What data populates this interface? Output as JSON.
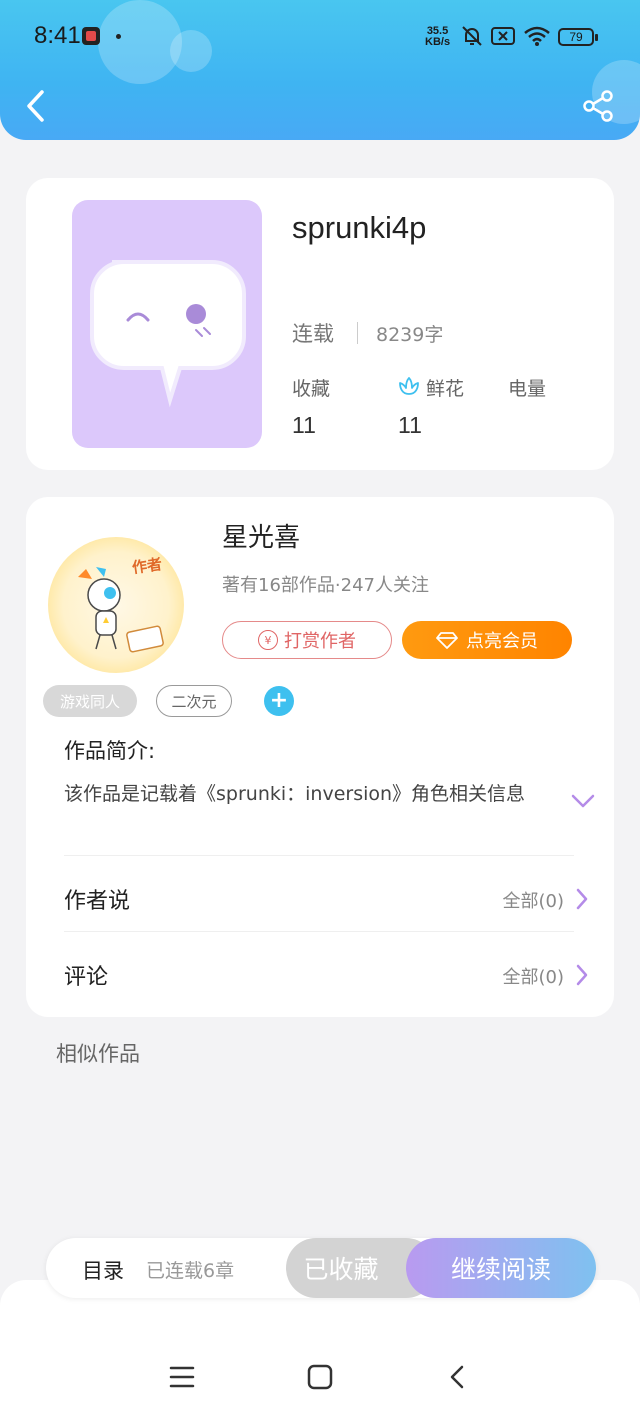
{
  "status_bar": {
    "time": "8:41",
    "net_speed_value": "35.5",
    "net_speed_unit": "KB/s",
    "battery": "79"
  },
  "book": {
    "title": "sprunki4p",
    "status": "连载",
    "word_count": "8239字",
    "stats": [
      {
        "label": "收藏",
        "value": "11"
      },
      {
        "label": "鲜花",
        "value": "11"
      },
      {
        "label": "电量",
        "value": ""
      }
    ]
  },
  "author": {
    "name": "星光喜",
    "meta": "著有16部作品·247人关注",
    "reward_label": "打赏作者",
    "vip_label": "点亮会员",
    "avatar_text": "作者"
  },
  "tags": [
    "游戏同人",
    "二次元"
  ],
  "intro": {
    "title": "作品简介:",
    "text": "该作品是记载着《sprunki：inversion》角色相关信息"
  },
  "rows": [
    {
      "label": "作者说",
      "count": "全部(0)"
    },
    {
      "label": "评论",
      "count": "全部(0)"
    }
  ],
  "similar_title": "相似作品",
  "bottom": {
    "toc_label": "目录",
    "toc_count": "已连载6章",
    "collected_label": "已收藏",
    "continue_label": "继续阅读"
  },
  "colors": {
    "header": "#45bbf1",
    "accent_purple": "#b48be8",
    "accent_orange": "#ff8c00",
    "cover_bg": "#dcc8fb"
  },
  "icons": [
    "back-icon",
    "share-icon",
    "flower-icon",
    "yen-icon",
    "diamond-icon",
    "plus-icon",
    "chevron-down-icon",
    "chevron-right-icon",
    "menu-icon",
    "home-icon",
    "nav-back-icon"
  ]
}
